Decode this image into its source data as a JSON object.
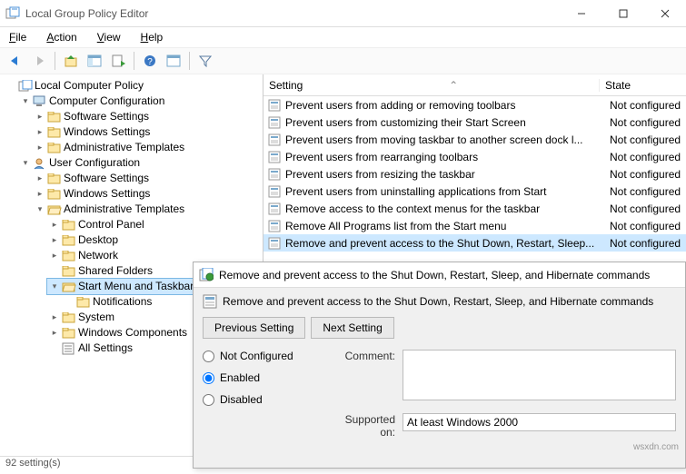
{
  "window": {
    "title": "Local Group Policy Editor"
  },
  "menubar": [
    "File",
    "Action",
    "View",
    "Help"
  ],
  "tree": {
    "root": "Local Computer Policy",
    "cc": "Computer Configuration",
    "uc": "User Configuration",
    "ss": "Software Settings",
    "ws": "Windows Settings",
    "at": "Administrative Templates",
    "cp": "Control Panel",
    "dk": "Desktop",
    "nw": "Network",
    "sf": "Shared Folders",
    "smt": "Start Menu and Taskbar",
    "nt": "Notifications",
    "sy": "System",
    "wc": "Windows Components",
    "as": "All Settings"
  },
  "list": {
    "columns": {
      "setting": "Setting",
      "state": "State"
    },
    "rows": [
      {
        "name": "Prevent users from adding or removing toolbars",
        "state": "Not configured"
      },
      {
        "name": "Prevent users from customizing their Start Screen",
        "state": "Not configured"
      },
      {
        "name": "Prevent users from moving taskbar to another screen dock l...",
        "state": "Not configured"
      },
      {
        "name": "Prevent users from rearranging toolbars",
        "state": "Not configured"
      },
      {
        "name": "Prevent users from resizing the taskbar",
        "state": "Not configured"
      },
      {
        "name": "Prevent users from uninstalling applications from Start",
        "state": "Not configured"
      },
      {
        "name": "Remove access to the context menus for the taskbar",
        "state": "Not configured"
      },
      {
        "name": "Remove All Programs list from the Start menu",
        "state": "Not configured"
      },
      {
        "name": "Remove and prevent access to the Shut Down, Restart, Sleep...",
        "state": "Not configured",
        "selected": true
      }
    ]
  },
  "dialog": {
    "title": "Remove and prevent access to the Shut Down, Restart, Sleep, and Hibernate commands",
    "heading": "Remove and prevent access to the Shut Down, Restart, Sleep, and Hibernate commands",
    "prev_btn": "Previous Setting",
    "next_btn": "Next Setting",
    "opt_nc": "Not Configured",
    "opt_en": "Enabled",
    "opt_di": "Disabled",
    "comment_label": "Comment:",
    "supported_label": "Supported on:",
    "supported_value": "At least Windows 2000"
  },
  "status": {
    "count": "92 setting(s)"
  },
  "watermark": "wsxdn.com"
}
